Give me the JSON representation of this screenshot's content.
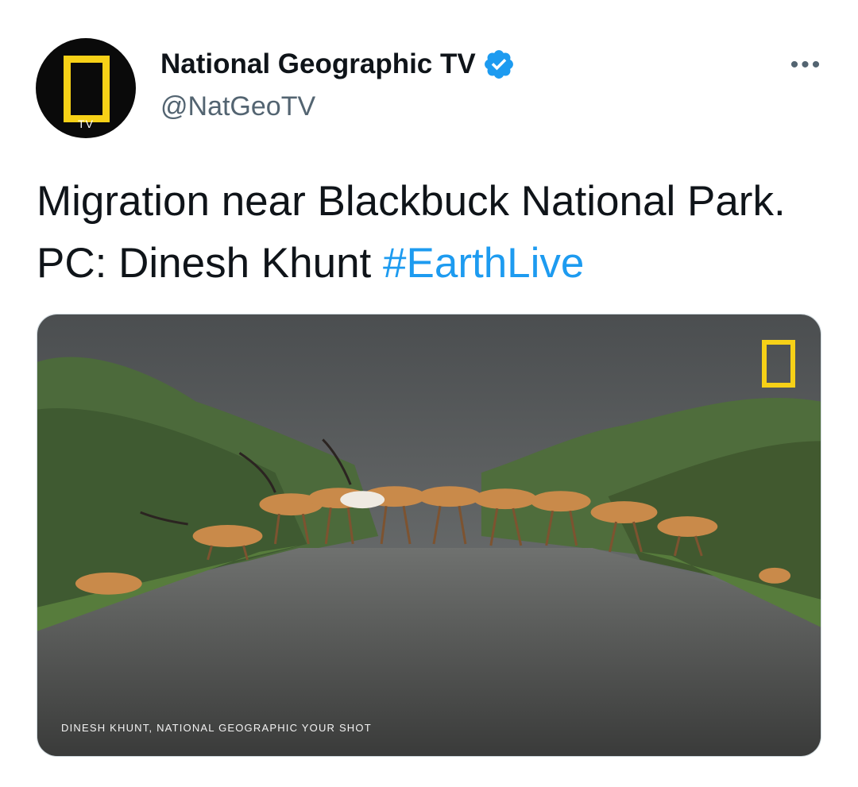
{
  "profile": {
    "avatar_label": "TV",
    "display_name": "National Geographic TV",
    "handle": "@NatGeoTV",
    "verified": true
  },
  "menu": {
    "more_label": "•••"
  },
  "tweet": {
    "text": "Migration near Blackbuck National Park. PC: Dinesh Khunt",
    "hashtag": "#EarthLive"
  },
  "media": {
    "caption": "DINESH KHUNT, NATIONAL GEOGRAPHIC YOUR SHOT",
    "alt": "Herd of blackbuck antelope crossing a rain-soaked road between green shrubs"
  },
  "colors": {
    "link": "#1d9bf0",
    "verified_badge": "#1d9bf0",
    "natgeo_yellow": "#f7d117",
    "secondary_text": "#536471"
  }
}
